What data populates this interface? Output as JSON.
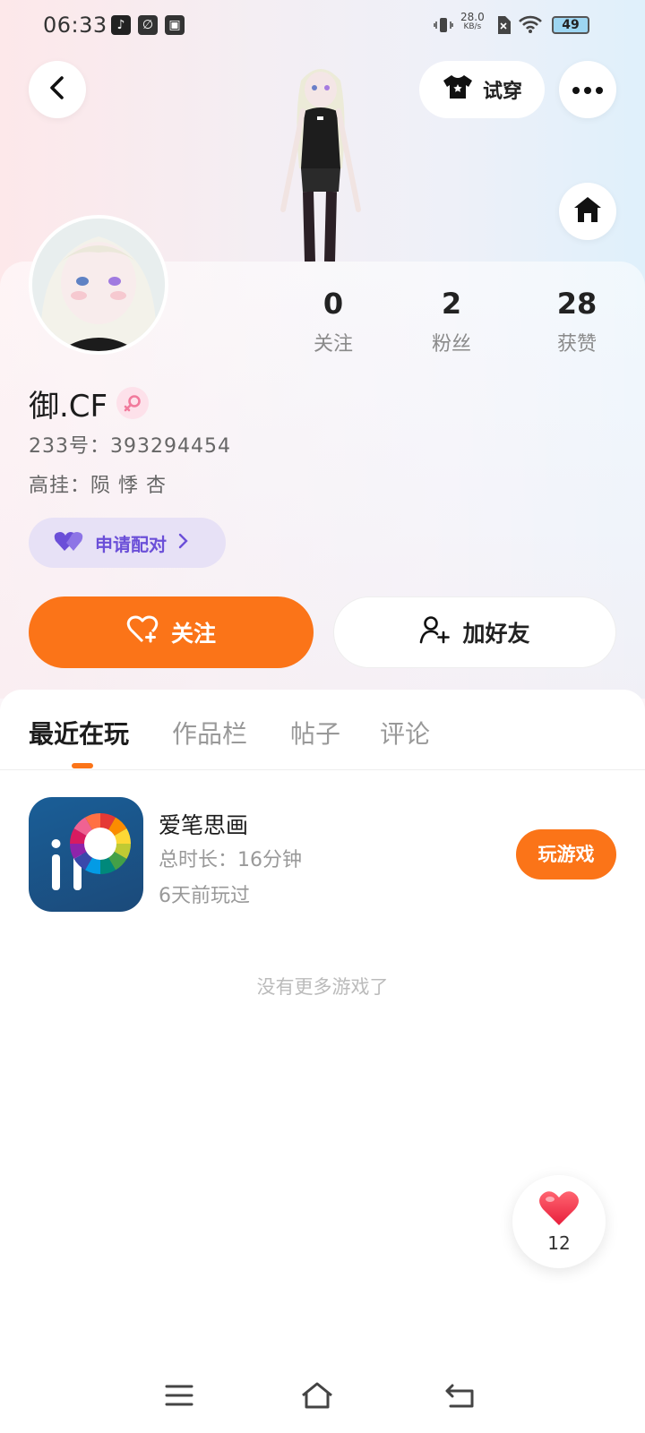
{
  "status_bar": {
    "time": "06:33",
    "net_speed_value": "28.0",
    "net_speed_unit": "KB/s",
    "battery": "49",
    "icons": [
      "tiktok-icon",
      "leaf-app-icon",
      "store-app-icon",
      "vibrate-icon",
      "sim-off-icon",
      "wifi-icon",
      "battery-icon"
    ]
  },
  "header": {
    "back_icon": "chevron-left-icon",
    "tryon_label": "试穿",
    "tryon_icon": "tshirt-icon",
    "more_icon": "more-dots-icon",
    "home_icon": "home-icon"
  },
  "profile": {
    "username": "御.CF",
    "gender": "female",
    "id_line": "233号：393294454",
    "status_line": "高挂：陨 悸 杏",
    "match_label": "申请配对",
    "stats": [
      {
        "value": "0",
        "label": "关注"
      },
      {
        "value": "2",
        "label": "粉丝"
      },
      {
        "value": "28",
        "label": "获赞"
      }
    ]
  },
  "actions": {
    "follow_label": "关注",
    "add_friend_label": "加好友"
  },
  "tabs": [
    {
      "label": "最近在玩",
      "active": true
    },
    {
      "label": "作品栏",
      "active": false
    },
    {
      "label": "帖子",
      "active": false
    },
    {
      "label": "评论",
      "active": false
    }
  ],
  "games": [
    {
      "name": "爱笔思画",
      "duration": "总时长：16分钟",
      "last_played": "6天前玩过",
      "play_label": "玩游戏"
    }
  ],
  "empty_text": "没有更多游戏了",
  "like": {
    "count": "12"
  },
  "colors": {
    "accent": "#fb7418",
    "match_purple": "#6b4fd8",
    "match_bg": "#e7e1f6",
    "like_red": "#f23a4a"
  }
}
